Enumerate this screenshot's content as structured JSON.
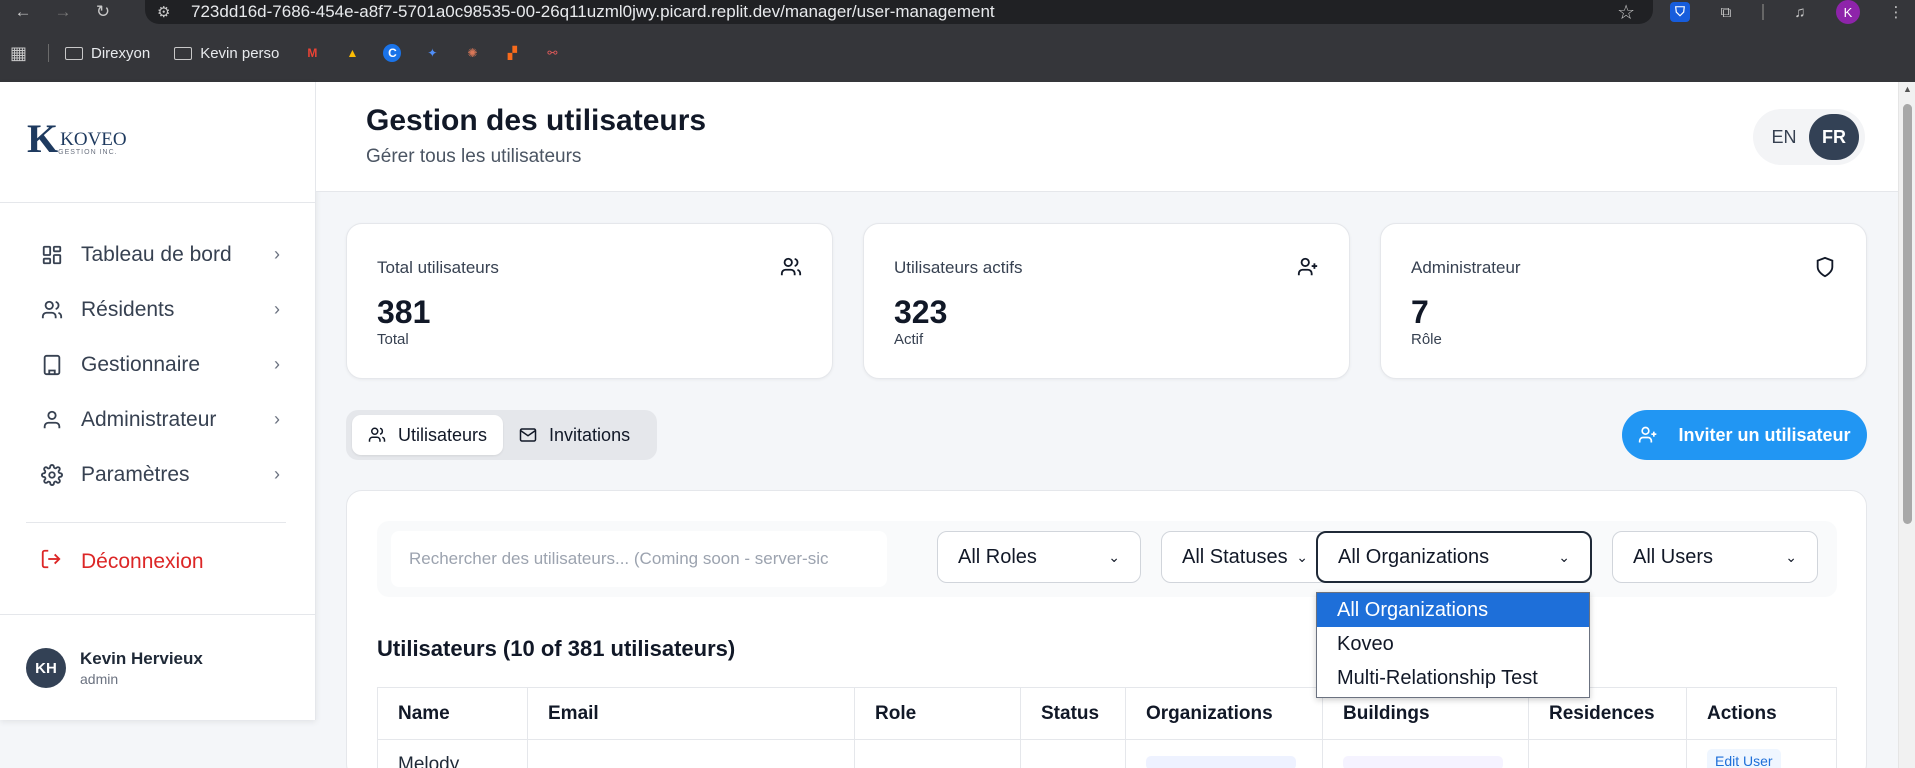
{
  "browser": {
    "url": "723dd16d-7686-454e-a8f7-5701a0c98535-00-26q11uzml0jwy.picard.replit.dev/manager/user-management",
    "bookmarks": [
      {
        "type": "folder",
        "label": "Direxyon"
      },
      {
        "type": "folder",
        "label": "Kevin perso"
      }
    ],
    "profile_initial": "K"
  },
  "sidebar": {
    "logo_text": "KOVEO",
    "logo_sub": "GESTION INC.",
    "nav": [
      {
        "label": "Tableau de bord",
        "icon": "dashboard-icon"
      },
      {
        "label": "Résidents",
        "icon": "users-icon"
      },
      {
        "label": "Gestionnaire",
        "icon": "building-icon"
      },
      {
        "label": "Administrateur",
        "icon": "user-icon"
      },
      {
        "label": "Paramètres",
        "icon": "gear-icon"
      }
    ],
    "logout_label": "Déconnexion",
    "user": {
      "initials": "KH",
      "name": "Kevin Hervieux",
      "role": "admin"
    }
  },
  "header": {
    "title": "Gestion des utilisateurs",
    "subtitle": "Gérer tous les utilisateurs",
    "lang_en": "EN",
    "lang_fr": "FR",
    "active_lang": "FR"
  },
  "stats": [
    {
      "label": "Total utilisateurs",
      "value": "381",
      "sub": "Total",
      "icon": "users-icon"
    },
    {
      "label": "Utilisateurs actifs",
      "value": "323",
      "sub": "Actif",
      "icon": "user-plus-icon"
    },
    {
      "label": "Administrateur",
      "value": "7",
      "sub": "Rôle",
      "icon": "shield-icon"
    }
  ],
  "tabs": [
    {
      "label": "Utilisateurs",
      "icon": "users-icon",
      "active": true
    },
    {
      "label": "Invitations",
      "icon": "mail-icon",
      "active": false
    }
  ],
  "invite_button": "Inviter un utilisateur",
  "filters": {
    "search_placeholder": "Rechercher des utilisateurs... (Coming soon - server-sic",
    "roles": "All Roles",
    "statuses": "All Statuses",
    "organizations": "All Organizations",
    "users": "All Users"
  },
  "org_dropdown": {
    "options": [
      "All Organizations",
      "Koveo",
      "Multi-Relationship Test"
    ],
    "selected": "All Organizations"
  },
  "users_section": {
    "title": "Utilisateurs (10 of 381 utilisateurs)",
    "columns": [
      "Name",
      "Email",
      "Role",
      "Status",
      "Organizations",
      "Buildings",
      "Residences",
      "Actions"
    ],
    "first_row": {
      "name": "Melody",
      "action": "Edit User"
    }
  },
  "colors": {
    "primary": "#2196f3",
    "danger": "#dc2626",
    "dark": "#334155",
    "selected_option": "#1e6fd9"
  }
}
